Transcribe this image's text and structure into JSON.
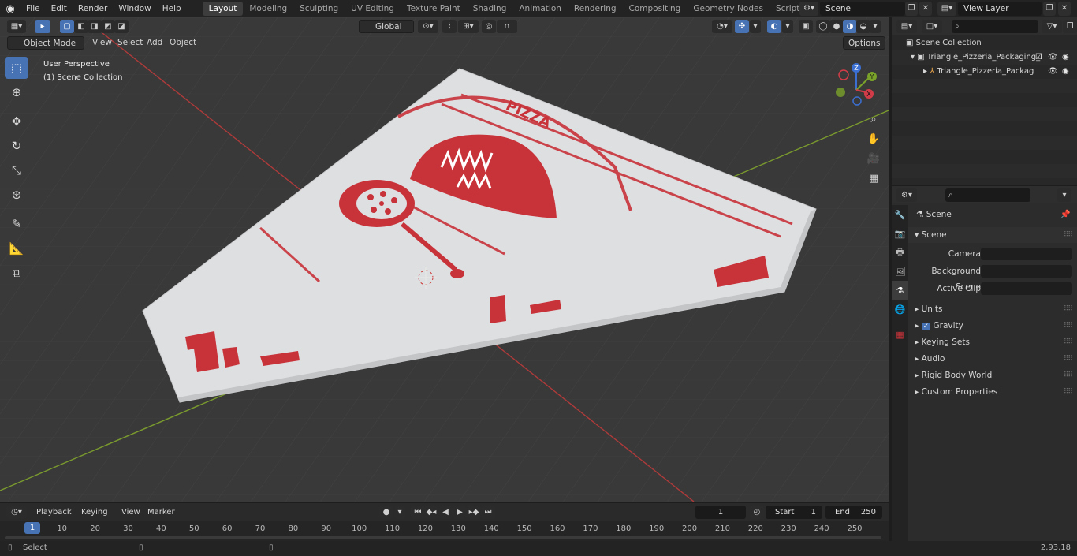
{
  "menu": [
    "File",
    "Edit",
    "Render",
    "Window",
    "Help"
  ],
  "workspaces": [
    "Layout",
    "Modeling",
    "Sculpting",
    "UV Editing",
    "Texture Paint",
    "Shading",
    "Animation",
    "Rendering",
    "Compositing",
    "Geometry Nodes",
    "Scripting"
  ],
  "active_workspace": "Layout",
  "scene_name": "Scene",
  "view_layer": "View Layer",
  "viewport": {
    "mode": "Object Mode",
    "menus": [
      "View",
      "Select",
      "Add",
      "Object"
    ],
    "orientation": "Global",
    "options_label": "Options",
    "perspective_label": "User Perspective",
    "collection_label": "(1) Scene Collection",
    "gizmo_axes": {
      "x": "X",
      "y": "Y",
      "z": "Z"
    },
    "model_text": {
      "brand": "PIZZA"
    }
  },
  "outliner": {
    "root": "Scene Collection",
    "items": [
      "Triangle_Pizzeria_Packaging_I",
      "Triangle_Pizzeria_Packag"
    ]
  },
  "properties": {
    "context": "Scene",
    "panel_title": "Scene",
    "fields": [
      {
        "label": "Camera",
        "value": ""
      },
      {
        "label": "Background Scene",
        "value": ""
      },
      {
        "label": "Active Clip",
        "value": ""
      }
    ],
    "subpanels": [
      "Units",
      "Gravity",
      "Keying Sets",
      "Audio",
      "Rigid Body World",
      "Custom Properties"
    ],
    "gravity_checked": true
  },
  "timeline": {
    "menus": [
      "Playback",
      "Keying",
      "View",
      "Marker"
    ],
    "current_frame": "1",
    "start_label": "Start",
    "start_value": "1",
    "end_label": "End",
    "end_value": "250",
    "ruler": [
      "1",
      "10",
      "20",
      "30",
      "40",
      "50",
      "60",
      "70",
      "80",
      "90",
      "100",
      "110",
      "120",
      "130",
      "140",
      "150",
      "160",
      "170",
      "180",
      "190",
      "200",
      "210",
      "220",
      "230",
      "240",
      "250"
    ]
  },
  "status": {
    "left": "Select",
    "version": "2.93.18"
  },
  "colors": {
    "accent": "#4772b3",
    "viewport_bg": "#393939",
    "print_red": "#c8333a",
    "axis_red": "#b03a3a",
    "axis_green": "#7a9a2e",
    "box_white": "#dedfe1"
  }
}
